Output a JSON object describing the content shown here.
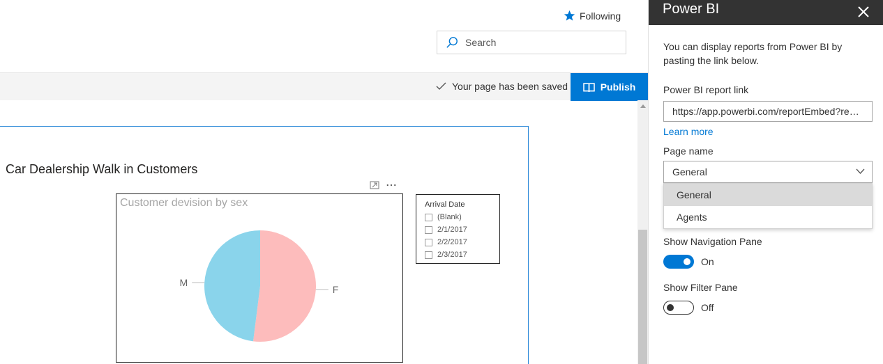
{
  "header": {
    "following_label": "Following",
    "search_placeholder": "Search"
  },
  "command_bar": {
    "saved_status": "Your page has been saved",
    "publish_label": "Publish"
  },
  "report": {
    "title": "Car Dealership Walk in Customers",
    "chart": {
      "title": "Customer devision by sex"
    },
    "slicer": {
      "title": "Arrival Date",
      "items": [
        "(Blank)",
        "2/1/2017",
        "2/2/2017",
        "2/3/2017"
      ]
    }
  },
  "chart_data": {
    "type": "pie",
    "title": "Customer devision by sex",
    "slices": [
      {
        "label": "F",
        "value": 52,
        "color": "#fdbcbc"
      },
      {
        "label": "M",
        "value": 48,
        "color": "#8ad4eb"
      }
    ]
  },
  "panel": {
    "title": "Power BI",
    "description": "You can display reports from Power BI by pasting the link below.",
    "report_link_label": "Power BI report link",
    "report_link_value": "https://app.powerbi.com/reportEmbed?reportId=",
    "learn_more": "Learn more",
    "page_name_label": "Page name",
    "page_name_value": "General",
    "page_options": [
      "General",
      "Agents"
    ],
    "nav_pane_label": "Show Navigation Pane",
    "nav_pane_state": "On",
    "filter_pane_label": "Show Filter Pane",
    "filter_pane_state": "Off"
  },
  "colors": {
    "accent": "#0078d4",
    "panel_header": "#333333"
  }
}
